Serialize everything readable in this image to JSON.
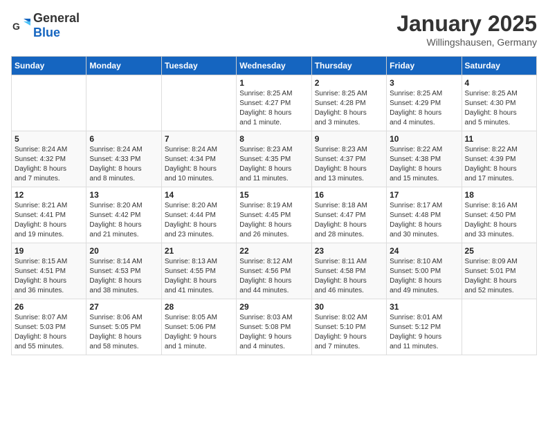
{
  "header": {
    "logo_general": "General",
    "logo_blue": "Blue",
    "month": "January 2025",
    "location": "Willingshausen, Germany"
  },
  "weekdays": [
    "Sunday",
    "Monday",
    "Tuesday",
    "Wednesday",
    "Thursday",
    "Friday",
    "Saturday"
  ],
  "weeks": [
    [
      {
        "day": "",
        "info": ""
      },
      {
        "day": "",
        "info": ""
      },
      {
        "day": "",
        "info": ""
      },
      {
        "day": "1",
        "info": "Sunrise: 8:25 AM\nSunset: 4:27 PM\nDaylight: 8 hours\nand 1 minute."
      },
      {
        "day": "2",
        "info": "Sunrise: 8:25 AM\nSunset: 4:28 PM\nDaylight: 8 hours\nand 3 minutes."
      },
      {
        "day": "3",
        "info": "Sunrise: 8:25 AM\nSunset: 4:29 PM\nDaylight: 8 hours\nand 4 minutes."
      },
      {
        "day": "4",
        "info": "Sunrise: 8:25 AM\nSunset: 4:30 PM\nDaylight: 8 hours\nand 5 minutes."
      }
    ],
    [
      {
        "day": "5",
        "info": "Sunrise: 8:24 AM\nSunset: 4:32 PM\nDaylight: 8 hours\nand 7 minutes."
      },
      {
        "day": "6",
        "info": "Sunrise: 8:24 AM\nSunset: 4:33 PM\nDaylight: 8 hours\nand 8 minutes."
      },
      {
        "day": "7",
        "info": "Sunrise: 8:24 AM\nSunset: 4:34 PM\nDaylight: 8 hours\nand 10 minutes."
      },
      {
        "day": "8",
        "info": "Sunrise: 8:23 AM\nSunset: 4:35 PM\nDaylight: 8 hours\nand 11 minutes."
      },
      {
        "day": "9",
        "info": "Sunrise: 8:23 AM\nSunset: 4:37 PM\nDaylight: 8 hours\nand 13 minutes."
      },
      {
        "day": "10",
        "info": "Sunrise: 8:22 AM\nSunset: 4:38 PM\nDaylight: 8 hours\nand 15 minutes."
      },
      {
        "day": "11",
        "info": "Sunrise: 8:22 AM\nSunset: 4:39 PM\nDaylight: 8 hours\nand 17 minutes."
      }
    ],
    [
      {
        "day": "12",
        "info": "Sunrise: 8:21 AM\nSunset: 4:41 PM\nDaylight: 8 hours\nand 19 minutes."
      },
      {
        "day": "13",
        "info": "Sunrise: 8:20 AM\nSunset: 4:42 PM\nDaylight: 8 hours\nand 21 minutes."
      },
      {
        "day": "14",
        "info": "Sunrise: 8:20 AM\nSunset: 4:44 PM\nDaylight: 8 hours\nand 23 minutes."
      },
      {
        "day": "15",
        "info": "Sunrise: 8:19 AM\nSunset: 4:45 PM\nDaylight: 8 hours\nand 26 minutes."
      },
      {
        "day": "16",
        "info": "Sunrise: 8:18 AM\nSunset: 4:47 PM\nDaylight: 8 hours\nand 28 minutes."
      },
      {
        "day": "17",
        "info": "Sunrise: 8:17 AM\nSunset: 4:48 PM\nDaylight: 8 hours\nand 30 minutes."
      },
      {
        "day": "18",
        "info": "Sunrise: 8:16 AM\nSunset: 4:50 PM\nDaylight: 8 hours\nand 33 minutes."
      }
    ],
    [
      {
        "day": "19",
        "info": "Sunrise: 8:15 AM\nSunset: 4:51 PM\nDaylight: 8 hours\nand 36 minutes."
      },
      {
        "day": "20",
        "info": "Sunrise: 8:14 AM\nSunset: 4:53 PM\nDaylight: 8 hours\nand 38 minutes."
      },
      {
        "day": "21",
        "info": "Sunrise: 8:13 AM\nSunset: 4:55 PM\nDaylight: 8 hours\nand 41 minutes."
      },
      {
        "day": "22",
        "info": "Sunrise: 8:12 AM\nSunset: 4:56 PM\nDaylight: 8 hours\nand 44 minutes."
      },
      {
        "day": "23",
        "info": "Sunrise: 8:11 AM\nSunset: 4:58 PM\nDaylight: 8 hours\nand 46 minutes."
      },
      {
        "day": "24",
        "info": "Sunrise: 8:10 AM\nSunset: 5:00 PM\nDaylight: 8 hours\nand 49 minutes."
      },
      {
        "day": "25",
        "info": "Sunrise: 8:09 AM\nSunset: 5:01 PM\nDaylight: 8 hours\nand 52 minutes."
      }
    ],
    [
      {
        "day": "26",
        "info": "Sunrise: 8:07 AM\nSunset: 5:03 PM\nDaylight: 8 hours\nand 55 minutes."
      },
      {
        "day": "27",
        "info": "Sunrise: 8:06 AM\nSunset: 5:05 PM\nDaylight: 8 hours\nand 58 minutes."
      },
      {
        "day": "28",
        "info": "Sunrise: 8:05 AM\nSunset: 5:06 PM\nDaylight: 9 hours\nand 1 minute."
      },
      {
        "day": "29",
        "info": "Sunrise: 8:03 AM\nSunset: 5:08 PM\nDaylight: 9 hours\nand 4 minutes."
      },
      {
        "day": "30",
        "info": "Sunrise: 8:02 AM\nSunset: 5:10 PM\nDaylight: 9 hours\nand 7 minutes."
      },
      {
        "day": "31",
        "info": "Sunrise: 8:01 AM\nSunset: 5:12 PM\nDaylight: 9 hours\nand 11 minutes."
      },
      {
        "day": "",
        "info": ""
      }
    ]
  ]
}
